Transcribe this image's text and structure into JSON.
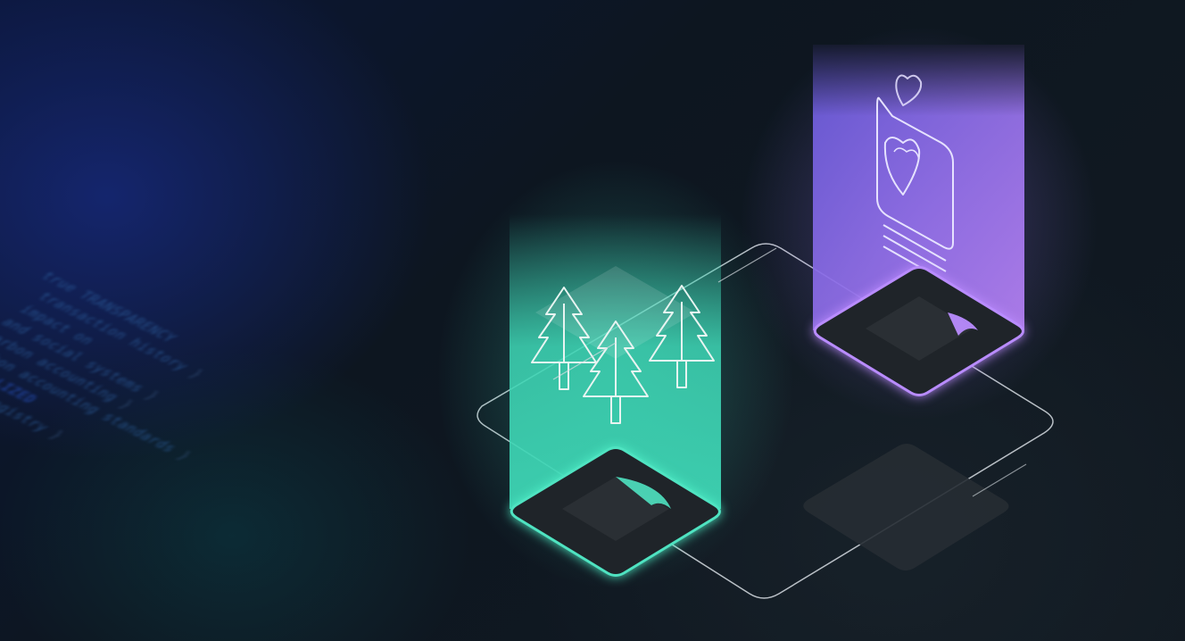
{
  "code_lines": [
    {
      "keyword": "",
      "text": "true TRANSPARENCY"
    },
    {
      "keyword": "",
      "text": "transaction history"
    },
    {
      "keyword": "",
      "text": "impact on"
    },
    {
      "keyword": "",
      "text": "and social systems"
    },
    {
      "keyword": "",
      "text": "carbon accounting"
    },
    {
      "keyword": "",
      "text": "carbon accounting standards"
    },
    {
      "keyword": "",
      "text": "DECENTRALIZED"
    },
    {
      "keyword": "",
      "text": "carbon registry"
    }
  ],
  "colors": {
    "green_accent": "#4fe3c1",
    "purple_accent": "#b98cff",
    "tile_dark": "#24282d",
    "outline": "#d7dde3"
  },
  "icons": [
    "tree-icon",
    "tree-icon",
    "tree-icon",
    "heart-card-icon",
    "heart-icon"
  ]
}
